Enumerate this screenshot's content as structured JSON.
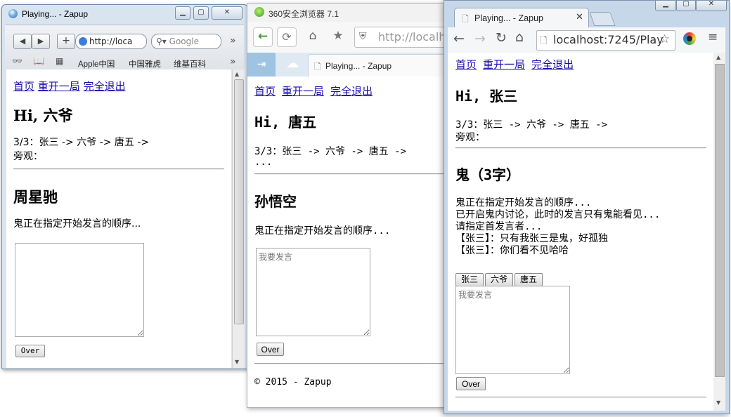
{
  "w1": {
    "title": "Playing... - Zapup",
    "url": "http://loca",
    "search_placeholder": "Google",
    "bookmarks": [
      "Apple中国",
      "中国雅虎",
      "维基百科"
    ],
    "nav": [
      "首页",
      "重开一局",
      "完全退出"
    ],
    "greeting": "Hi, 六爷",
    "order": "3/3：张三 -> 六爷 -> 唐五 ->",
    "spectator": "旁观：",
    "role": "周星驰",
    "status": "鬼正在指定开始发言的顺序...",
    "over": "Over"
  },
  "w2": {
    "title": "360安全浏览器 7.1",
    "url": "http://localh",
    "tab_title": "Playing... - Zapup",
    "nav": [
      "首页",
      "重开一局",
      "完全退出"
    ],
    "greeting": "Hi, 唐五",
    "order": "3/3：张三 -> 六爷 -> 唐五 ->",
    "dots": "...",
    "role": "孙悟空",
    "status": "鬼正在指定开始发言的顺序...",
    "placeholder": "我要发言",
    "over": "Over",
    "footer": "© 2015 - Zapup"
  },
  "w3": {
    "tab_title": "Playing... - Zapup",
    "url": "localhost:7245/Play",
    "nav": [
      "首页",
      "重开一局",
      "完全退出"
    ],
    "greeting": "Hi, 张三",
    "order": "3/3：张三 -> 六爷 -> 唐五 ->",
    "spectator": "旁观：",
    "role": "鬼（3字）",
    "messages": [
      "鬼正在指定开始发言的顺序...",
      "已开启鬼内讨论，此时的发言只有鬼能看见...",
      "请指定首发言者...",
      "【张三】：只有我张三是鬼，好孤独",
      "【张三】：你们看不见哈哈"
    ],
    "players": [
      "张三",
      "六爷",
      "唐五"
    ],
    "placeholder": "我要发言",
    "over": "Over"
  },
  "colors": {
    "link": "#1a0dab",
    "accent_green": "#3a9a2a"
  }
}
